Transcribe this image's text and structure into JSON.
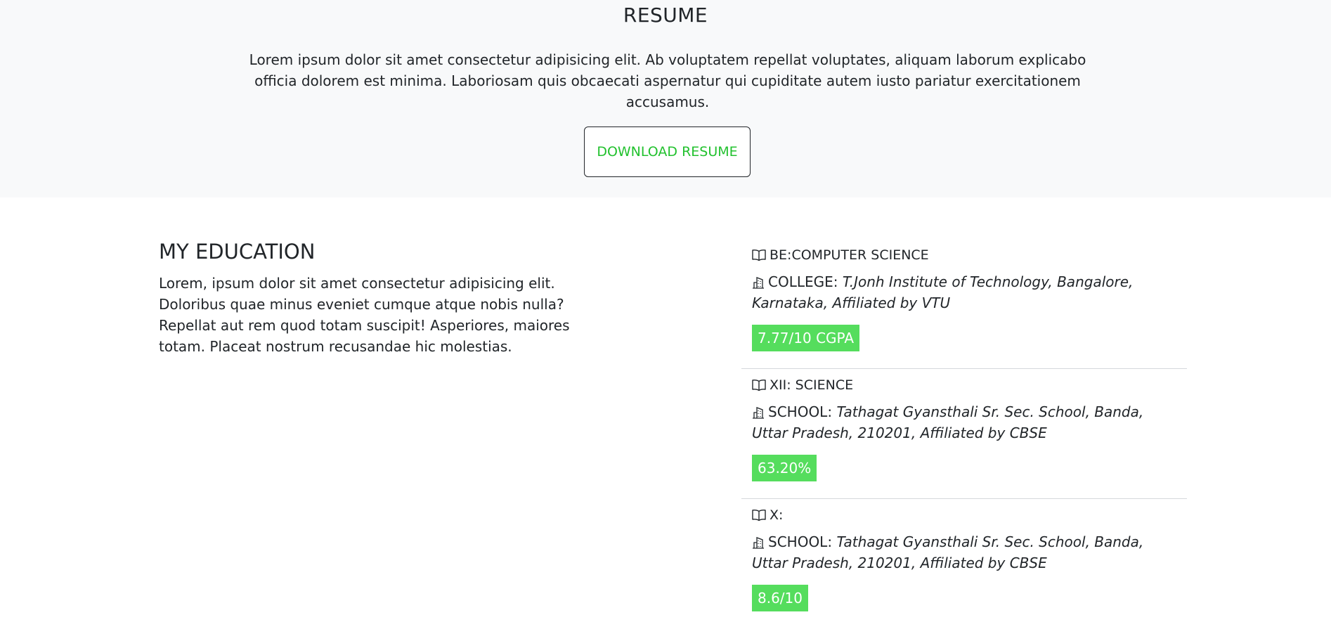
{
  "resume": {
    "title": "RESUME",
    "intro": "Lorem ipsum dolor sit amet consectetur adipisicing elit. Ab voluptatem repellat voluptates, aliquam laborum explicabo officia dolorem est minima. Laboriosam quis obcaecati aspernatur qui cupiditate autem iusto pariatur exercitationem accusamus.",
    "download_label": "DOWNLOAD RESUME"
  },
  "education": {
    "heading": "MY EDUCATION",
    "description": "Lorem, ipsum dolor sit amet consectetur adipisicing elit. Doloribus quae minus eveniet cumque atque nobis nulla? Repellat aut rem quod totam suscipit! Asperiores, maiores totam. Placeat nostrum recusandae hic molestias.",
    "items": [
      {
        "degree": "BE:COMPUTER SCIENCE",
        "institution_label": "COLLEGE:",
        "institution": "T.Jonh Institute of Technology, Bangalore, Karnataka, Affiliated by VTU",
        "score": "7.77/10 CGPA"
      },
      {
        "degree": "XII: SCIENCE",
        "institution_label": "SCHOOL:",
        "institution": "Tathagat Gyansthali Sr. Sec. School, Banda, Uttar Pradesh, 210201, Affiliated by CBSE",
        "score": "63.20%"
      },
      {
        "degree": "X:",
        "institution_label": "SCHOOL:",
        "institution": "Tathagat Gyansthali Sr. Sec. School, Banda, Uttar Pradesh, 210201, Affiliated by CBSE",
        "score": "8.6/10"
      }
    ]
  },
  "icons": {
    "degree": "book-icon",
    "institution": "building-icon"
  },
  "colors": {
    "accent_green": "#55dd5d",
    "button_text_green": "#22c12e",
    "hero_background": "#f8f9fa"
  }
}
